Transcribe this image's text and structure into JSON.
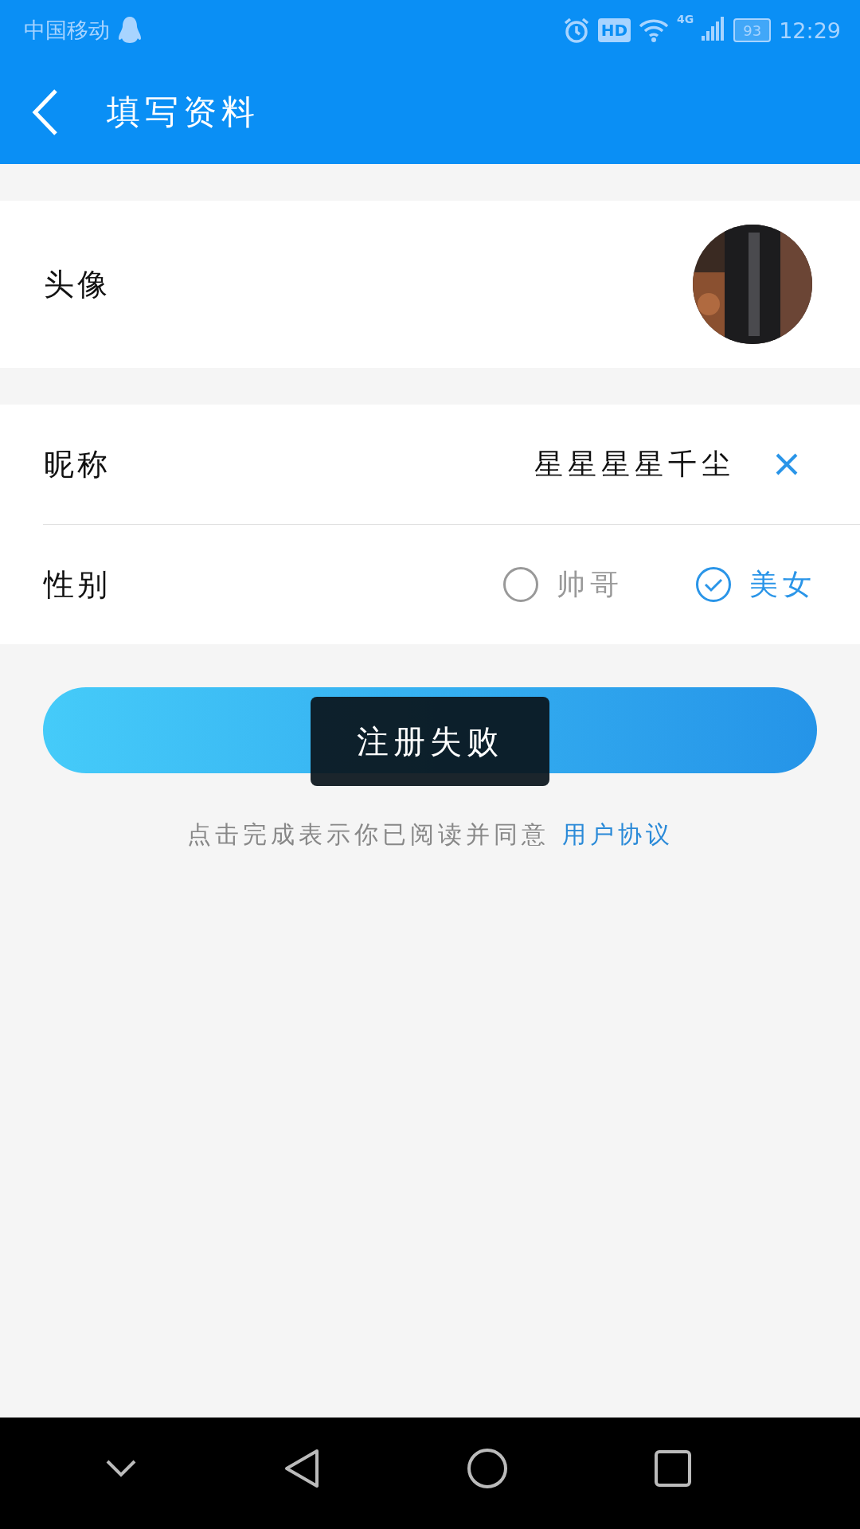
{
  "status_bar": {
    "carrier": "中国移动",
    "hd": "HD",
    "network": "4G",
    "battery": "93",
    "time": "12:29"
  },
  "header": {
    "title": "填写资料"
  },
  "avatar": {
    "label": "头像"
  },
  "nickname": {
    "label": "昵称",
    "value": "星星星星千尘"
  },
  "gender": {
    "label": "性别",
    "options": [
      {
        "label": "帅哥",
        "selected": false
      },
      {
        "label": "美女",
        "selected": true
      }
    ]
  },
  "submit": {
    "kind": "button"
  },
  "toast": {
    "text": "注册失败"
  },
  "agreement": {
    "text": "点击完成表示你已阅读并同意",
    "link": "用户协议"
  }
}
